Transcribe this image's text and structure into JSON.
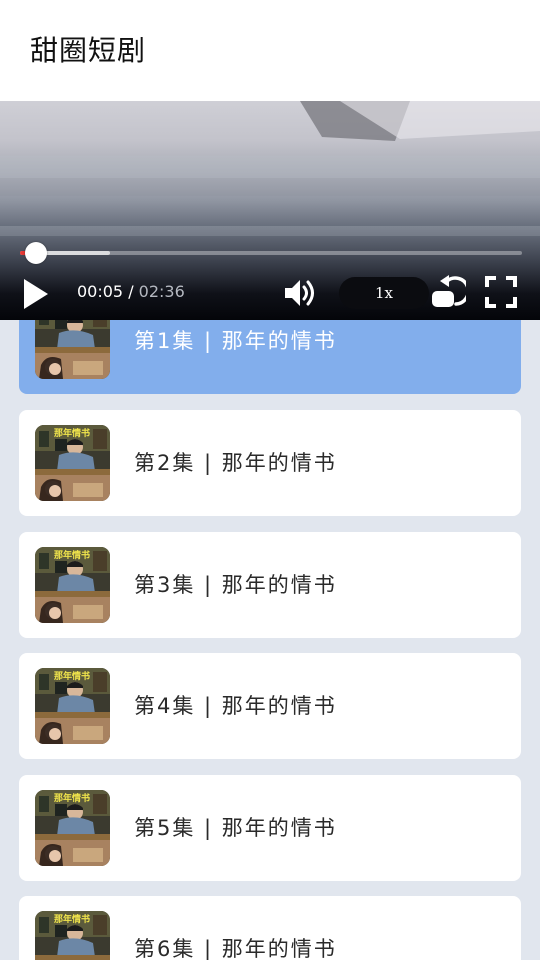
{
  "app": {
    "title": "甜圈短剧"
  },
  "player": {
    "current_time": "00:05",
    "separator": " / ",
    "duration": "02:36",
    "speed": "1x",
    "progress_fraction": 0.032,
    "buffered_fraction": 0.18,
    "colors": {
      "played": "#e53935",
      "knob": "#ffffff"
    },
    "icons": [
      "play-icon",
      "volume-icon",
      "replay-icon",
      "fullscreen-icon"
    ]
  },
  "episodes": [
    {
      "label": "第1集 | 那年的情书",
      "active": true
    },
    {
      "label": "第2集 | 那年的情书",
      "active": false
    },
    {
      "label": "第3集 | 那年的情书",
      "active": false
    },
    {
      "label": "第4集 | 那年的情书",
      "active": false
    },
    {
      "label": "第5集 | 那年的情书",
      "active": false
    },
    {
      "label": "第6集 | 那年的情书",
      "active": false
    }
  ],
  "colors": {
    "active_card": "#82aeec",
    "card": "#ffffff",
    "list_background": "#e1e6ee"
  }
}
